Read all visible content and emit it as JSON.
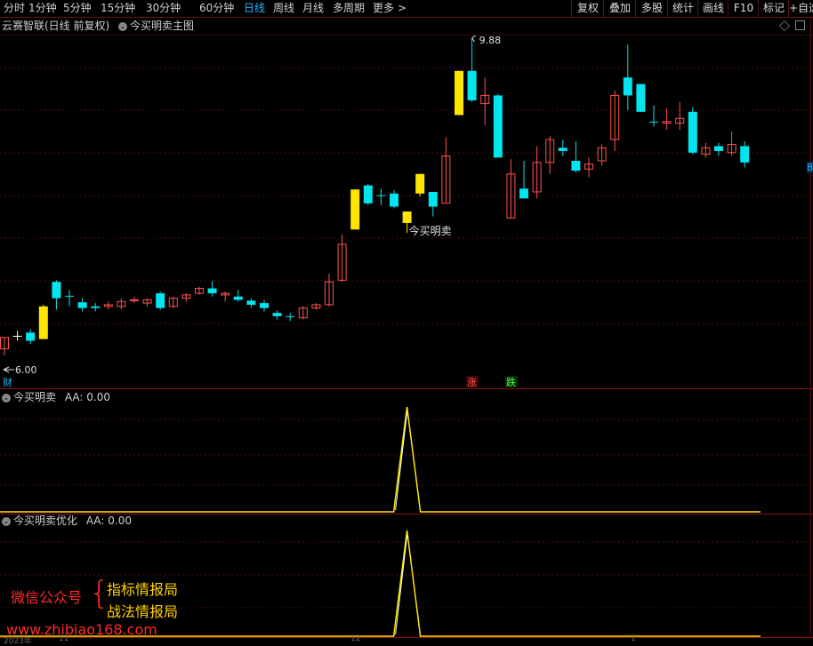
{
  "toolbar": {
    "timeframes": [
      "分时",
      "1分钟",
      "5分钟",
      "15分钟",
      "30分钟",
      "60分钟",
      "日线",
      "周线",
      "月线",
      "多周期",
      "更多 >"
    ],
    "active_timeframe": "日线",
    "buttons": [
      "复权",
      "叠加",
      "多股",
      "统计",
      "画线",
      "F10",
      "标记",
      "+自选"
    ]
  },
  "main_panel": {
    "stock": "云赛智联(日线 前复权)",
    "indicator": "今买明卖主图",
    "high_label": "9.88",
    "low_label": "6.00",
    "signal_label": "今买明卖",
    "markers": {
      "cai": "财",
      "zhang": "涨",
      "die": "跌"
    },
    "right_edge_label": "8"
  },
  "panel1": {
    "title": "今买明卖",
    "value_label": "AA: 0.00"
  },
  "panel2": {
    "title": "今买明卖优化",
    "value_label": "AA: 0.00"
  },
  "watermark": {
    "left": "微信公众号",
    "brace": "{",
    "right1": "指标情报局",
    "right2": "战法情报局",
    "url": "www.zhibiao168.com"
  },
  "bottom_axis": {
    "labels": [
      "2023年",
      "11",
      "12",
      "1"
    ]
  },
  "colors": {
    "up": "#ff5050",
    "down": "#00e5ee",
    "signal": "#ffe600",
    "grid": "#6b0f0f",
    "accent": "#21b6ff"
  },
  "chart_data": {
    "type": "candlestick",
    "price_range": [
      6.0,
      9.88
    ],
    "candles": [
      {
        "o": 6.08,
        "c": 6.22,
        "h": 6.22,
        "l": 6.0,
        "color": "up"
      },
      {
        "o": 6.24,
        "c": 6.24,
        "h": 6.3,
        "l": 6.18,
        "color": "flat"
      },
      {
        "o": 6.28,
        "c": 6.18,
        "h": 6.32,
        "l": 6.14,
        "color": "down"
      },
      {
        "o": 6.2,
        "c": 6.6,
        "h": 6.62,
        "l": 6.2,
        "color": "signal"
      },
      {
        "o": 6.9,
        "c": 6.7,
        "h": 6.92,
        "l": 6.56,
        "color": "down"
      },
      {
        "o": 6.73,
        "c": 6.72,
        "h": 6.8,
        "l": 6.6,
        "color": "down"
      },
      {
        "o": 6.65,
        "c": 6.58,
        "h": 6.7,
        "l": 6.54,
        "color": "down"
      },
      {
        "o": 6.6,
        "c": 6.58,
        "h": 6.64,
        "l": 6.54,
        "color": "down"
      },
      {
        "o": 6.6,
        "c": 6.62,
        "h": 6.66,
        "l": 6.56,
        "color": "up"
      },
      {
        "o": 6.6,
        "c": 6.66,
        "h": 6.7,
        "l": 6.56,
        "color": "up"
      },
      {
        "o": 6.68,
        "c": 6.68,
        "h": 6.72,
        "l": 6.64,
        "color": "up"
      },
      {
        "o": 6.64,
        "c": 6.68,
        "h": 6.7,
        "l": 6.6,
        "color": "up"
      },
      {
        "o": 6.76,
        "c": 6.58,
        "h": 6.78,
        "l": 6.56,
        "color": "down"
      },
      {
        "o": 6.6,
        "c": 6.7,
        "h": 6.72,
        "l": 6.58,
        "color": "up"
      },
      {
        "o": 6.7,
        "c": 6.74,
        "h": 6.76,
        "l": 6.66,
        "color": "up"
      },
      {
        "o": 6.76,
        "c": 6.82,
        "h": 6.84,
        "l": 6.74,
        "color": "up"
      },
      {
        "o": 6.82,
        "c": 6.76,
        "h": 6.91,
        "l": 6.72,
        "color": "down"
      },
      {
        "o": 6.74,
        "c": 6.76,
        "h": 6.78,
        "l": 6.66,
        "color": "up"
      },
      {
        "o": 6.72,
        "c": 6.68,
        "h": 6.8,
        "l": 6.66,
        "color": "down"
      },
      {
        "o": 6.67,
        "c": 6.62,
        "h": 6.7,
        "l": 6.58,
        "color": "down"
      },
      {
        "o": 6.64,
        "c": 6.58,
        "h": 6.68,
        "l": 6.54,
        "color": "down"
      },
      {
        "o": 6.52,
        "c": 6.48,
        "h": 6.55,
        "l": 6.44,
        "color": "down"
      },
      {
        "o": 6.48,
        "c": 6.48,
        "h": 6.52,
        "l": 6.42,
        "color": "down"
      },
      {
        "o": 6.46,
        "c": 6.58,
        "h": 6.6,
        "l": 6.44,
        "color": "up"
      },
      {
        "o": 6.58,
        "c": 6.62,
        "h": 6.64,
        "l": 6.56,
        "color": "up"
      },
      {
        "o": 6.62,
        "c": 6.9,
        "h": 7.0,
        "l": 6.6,
        "color": "up"
      },
      {
        "o": 6.92,
        "c": 7.36,
        "h": 7.48,
        "l": 6.9,
        "color": "up"
      },
      {
        "o": 7.54,
        "c": 8.03,
        "h": 8.03,
        "l": 7.54,
        "color": "signal"
      },
      {
        "o": 8.08,
        "c": 7.86,
        "h": 8.1,
        "l": 7.84,
        "color": "down"
      },
      {
        "o": 7.96,
        "c": 7.96,
        "h": 8.04,
        "l": 7.84,
        "color": "flat_down"
      },
      {
        "o": 7.98,
        "c": 7.82,
        "h": 8.02,
        "l": 7.8,
        "color": "down"
      },
      {
        "o": 7.62,
        "c": 7.76,
        "h": 7.76,
        "l": 7.5,
        "color": "signal"
      },
      {
        "o": 7.98,
        "c": 8.22,
        "h": 8.22,
        "l": 7.94,
        "color": "signal"
      },
      {
        "o": 8.0,
        "c": 7.82,
        "h": 8.0,
        "l": 7.7,
        "color": "down"
      },
      {
        "o": 7.86,
        "c": 8.44,
        "h": 8.67,
        "l": 7.86,
        "color": "up"
      },
      {
        "o": 8.94,
        "c": 9.48,
        "h": 9.48,
        "l": 8.94,
        "color": "signal"
      },
      {
        "o": 9.48,
        "c": 9.12,
        "h": 9.88,
        "l": 9.1,
        "color": "down"
      },
      {
        "o": 9.08,
        "c": 9.18,
        "h": 9.4,
        "l": 8.82,
        "color": "up"
      },
      {
        "o": 9.18,
        "c": 8.42,
        "h": 9.2,
        "l": 8.42,
        "color": "down"
      },
      {
        "o": 7.68,
        "c": 8.22,
        "h": 8.4,
        "l": 7.68,
        "color": "up"
      },
      {
        "o": 8.04,
        "c": 7.92,
        "h": 8.38,
        "l": 7.92,
        "color": "down"
      },
      {
        "o": 8.0,
        "c": 8.36,
        "h": 8.56,
        "l": 7.92,
        "color": "up"
      },
      {
        "o": 8.36,
        "c": 8.64,
        "h": 8.68,
        "l": 8.22,
        "color": "up"
      },
      {
        "o": 8.54,
        "c": 8.5,
        "h": 8.64,
        "l": 8.44,
        "color": "down"
      },
      {
        "o": 8.38,
        "c": 8.26,
        "h": 8.62,
        "l": 8.24,
        "color": "down"
      },
      {
        "o": 8.28,
        "c": 8.34,
        "h": 8.42,
        "l": 8.18,
        "color": "up"
      },
      {
        "o": 8.38,
        "c": 8.54,
        "h": 8.58,
        "l": 8.32,
        "color": "up"
      },
      {
        "o": 8.64,
        "c": 9.18,
        "h": 9.24,
        "l": 8.5,
        "color": "up"
      },
      {
        "o": 9.4,
        "c": 9.18,
        "h": 9.8,
        "l": 9.0,
        "color": "down"
      },
      {
        "o": 9.32,
        "c": 8.98,
        "h": 9.32,
        "l": 8.98,
        "color": "down"
      },
      {
        "o": 8.86,
        "c": 8.86,
        "h": 9.06,
        "l": 8.8,
        "color": "flat_down"
      },
      {
        "o": 8.84,
        "c": 8.86,
        "h": 9.02,
        "l": 8.76,
        "color": "up"
      },
      {
        "o": 8.84,
        "c": 8.9,
        "h": 9.1,
        "l": 8.76,
        "color": "up"
      },
      {
        "o": 8.98,
        "c": 8.48,
        "h": 9.04,
        "l": 8.46,
        "color": "down"
      },
      {
        "o": 8.54,
        "c": 8.46,
        "h": 8.6,
        "l": 8.42,
        "color": "up"
      },
      {
        "o": 8.56,
        "c": 8.5,
        "h": 8.6,
        "l": 8.44,
        "color": "down"
      },
      {
        "o": 8.48,
        "c": 8.58,
        "h": 8.74,
        "l": 8.44,
        "color": "up"
      },
      {
        "o": 8.56,
        "c": 8.36,
        "h": 8.62,
        "l": 8.3,
        "color": "down"
      }
    ],
    "signal_index": 31,
    "panel1_series": {
      "name": "AA",
      "spike_index": 31,
      "spike_value": 1
    },
    "panel2_series": {
      "name": "AA",
      "spike_index": 31,
      "spike_value": 1
    }
  }
}
